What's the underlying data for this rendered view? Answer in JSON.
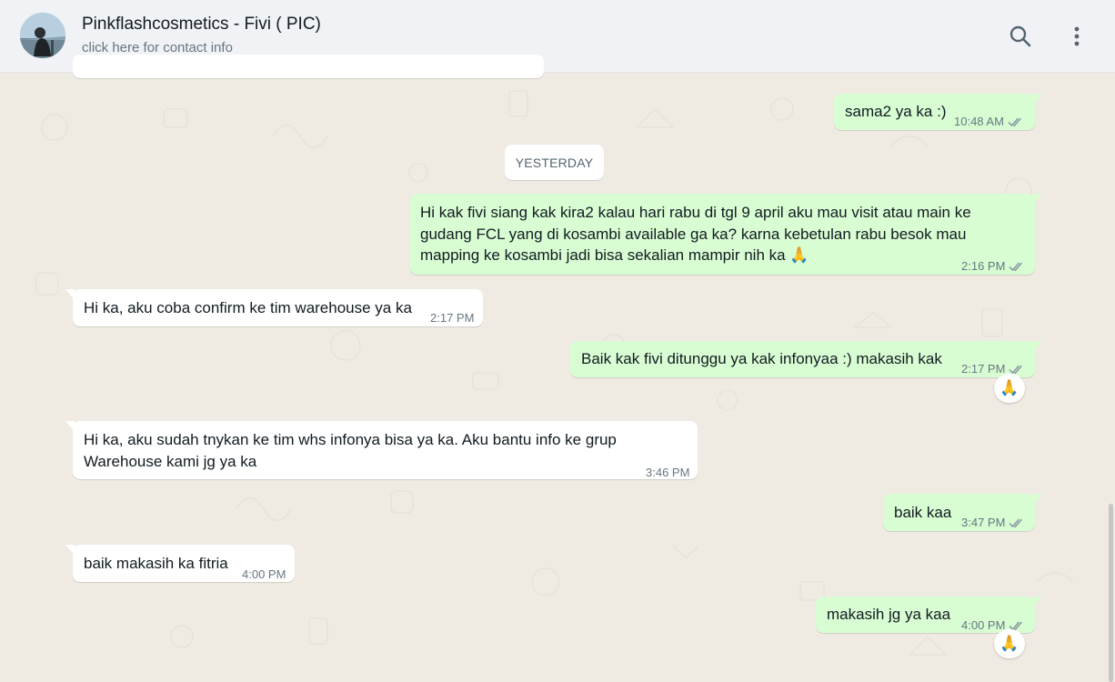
{
  "header": {
    "contact_name": "Pinkflashcosmetics - Fivi ( PIC)",
    "contact_sub": "click here for contact info",
    "icons": [
      "search-icon",
      "kebab-menu-icon"
    ]
  },
  "date_divider": "YESTERDAY",
  "messages": [
    {
      "direction": "out",
      "text": "sama2 ya ka :)",
      "time": "10:48 AM",
      "status": "read"
    },
    {
      "direction": "out",
      "lines": [
        "Hi kak fivi siang kak kira2 kalau hari rabu di tgl 9 april aku mau visit atau main ke",
        "gudang FCL yang di kosambi available ga ka? karna kebetulan rabu besok mau",
        "mapping ke kosambi jadi bisa sekalian mampir nih ka 🙏"
      ],
      "time": "2:16 PM",
      "status": "read"
    },
    {
      "direction": "in",
      "text": "Hi ka, aku coba confirm ke tim warehouse ya ka",
      "time": "2:17 PM"
    },
    {
      "direction": "out",
      "text": "Baik kak fivi ditunggu ya kak infonyaa :) makasih kak",
      "time": "2:17 PM",
      "status": "read",
      "reaction": "🙏"
    },
    {
      "direction": "in",
      "lines": [
        "Hi ka, aku sudah tnykan ke tim whs infonya bisa ya ka. Aku bantu info ke grup",
        "Warehouse kami jg ya ka"
      ],
      "time": "3:46 PM"
    },
    {
      "direction": "out",
      "text": "baik kaa",
      "time": "3:47 PM",
      "status": "read"
    },
    {
      "direction": "in",
      "text": "baik makasih ka fitria",
      "time": "4:00 PM"
    },
    {
      "direction": "out",
      "text": "makasih jg ya kaa",
      "time": "4:00 PM",
      "status": "read",
      "reaction": "🙏"
    }
  ],
  "colors": {
    "chat_bg": "#efeae2",
    "header_bg": "#f0f2f5",
    "outgoing_bubble": "#d9fdd3",
    "incoming_bubble": "#ffffff",
    "read_ticks": "#8696a0"
  }
}
